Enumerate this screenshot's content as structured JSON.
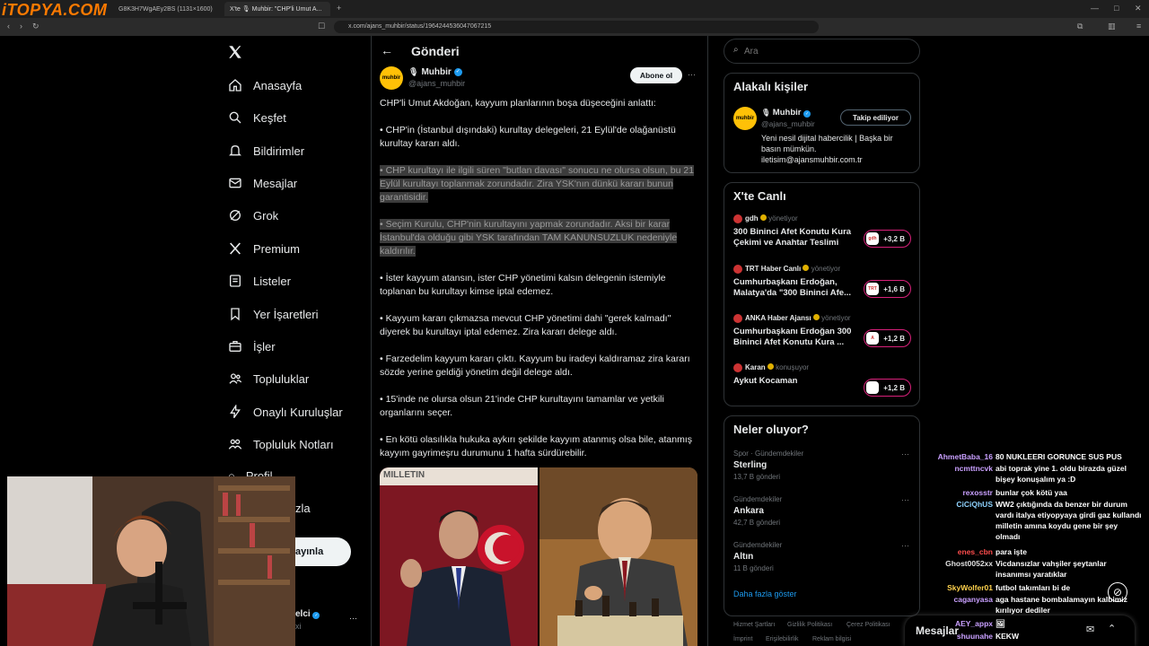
{
  "browser": {
    "logo_text": "iTOPYA.COM",
    "tabs": [
      {
        "label": "G8K3H7WgAEy2BS (1131×1600)"
      },
      {
        "label": "X'te 🎙 Muhbir: \"CHP'li Umut A..."
      }
    ],
    "url": "x.com/ajans_muhbir/status/1964244536047067215",
    "new_tab_symbol": "+"
  },
  "nav": {
    "items": [
      {
        "label": "Anasayfa",
        "icon": "home-icon"
      },
      {
        "label": "Keşfet",
        "icon": "search-icon"
      },
      {
        "label": "Bildirimler",
        "icon": "bell-icon"
      },
      {
        "label": "Mesajlar",
        "icon": "mail-icon"
      },
      {
        "label": "Grok",
        "icon": "grok-icon"
      },
      {
        "label": "Premium",
        "icon": "x-icon"
      },
      {
        "label": "Listeler",
        "icon": "list-icon"
      },
      {
        "label": "Yer İşaretleri",
        "icon": "bookmark-icon"
      },
      {
        "label": "İşler",
        "icon": "briefcase-icon"
      },
      {
        "label": "Topluluklar",
        "icon": "people-icon"
      },
      {
        "label": "Onaylı Kuruluşlar",
        "icon": "bolt-icon"
      },
      {
        "label": "Topluluk Notları",
        "icon": "notes-icon"
      }
    ],
    "partial_labels": {
      "profil": "Profil",
      "more": "zla",
      "post_button": "ayınla",
      "account_name": "elci",
      "account_handle": "xi",
      "more_dots": "···"
    }
  },
  "post": {
    "header_title": "Gönderi",
    "author_name": "Muhbir",
    "author_handle": "@ajans_muhbir",
    "avatar_text": "muhbir",
    "subscribe_label": "Abone ol",
    "more_dots": "···",
    "paragraphs": [
      "CHP'li Umut Akdoğan, kayyum planlarının boşa düşeceğini anlattı:",
      "• CHP'in (İstanbul dışındaki) kurultay delegeleri, 21 Eylül'de olağanüstü kurultay kararı aldı.",
      "• CHP kurultayı ile ilgili süren \"butlan davası\" sonucu ne olursa olsun, bu 21 Eylül kurultayı toplanmak zorundadır. Zira YSK'nın dünkü kararı bunun garantisidir.",
      "• Seçim Kurulu, CHP'nin kurultayını yapmak zorundadır. Aksi bir karar İstanbul'da olduğu gibi YSK tarafından TAM KANUNSUZLUK nedeniyle kaldırılır.",
      "• İster kayyum atansın, ister CHP yönetimi kalsın delegenin istemiyle toplanan bu kurultayı kimse iptal edemez.",
      "• Kayyum kararı çıkmazsa mevcut CHP yönetimi dahi \"gerek kalmadı\" diyerek bu kurultayı iptal edemez. Zira kararı delege aldı.",
      "• Farzedelim kayyum kararı çıktı. Kayyum bu iradeyi kaldıramaz zira kararı sözde yerine geldiği yönetim değil delege aldı.",
      "• 15'inde ne olursa olsun 21'inde CHP kurultayını tamamlar ve yetkili organlarını seçer.",
      "• En kötü olasılıkla hukuka aykırı şekilde kayyım atanmış olsa bile, atanmış kayyım gayrimeşru durumunu 1 hafta sürdürebilir."
    ],
    "image_caption_text": "MILLETIN"
  },
  "search": {
    "placeholder": "Ara"
  },
  "related": {
    "title": "Alakalı kişiler",
    "name": "Muhbir",
    "handle": "@ajans_muhbir",
    "follow_label": "Takip ediliyor",
    "bio": "Yeni nesil dijital habercilik | Başka bir basın mümkün. iletisim@ajansmuhbir.com.tr",
    "avatar_text": "muhbir"
  },
  "live": {
    "title": "X'te Canlı",
    "items": [
      {
        "host": "gdh",
        "role": "yönetiyor",
        "title": "300 Bininci Afet Konutu Kura Çekimi ve Anahtar Teslimi",
        "count": "+3,2 B",
        "badge": "gdh"
      },
      {
        "host": "TRT Haber Canlı",
        "role": "yönetiyor",
        "title": "Cumhurbaşkanı Erdoğan, Malatya'da \"300 Bininci Afe...",
        "count": "+1,6 B",
        "badge": "TRT"
      },
      {
        "host": "ANKA Haber Ajansı",
        "role": "yönetiyor",
        "title": "Cumhurbaşkanı Erdoğan 300 Bininci Afet Konutu Kura ...",
        "count": "+1,2 B",
        "badge": "A"
      },
      {
        "host": "Karan",
        "role": "konuşuyor",
        "title": "Aykut Kocaman",
        "count": "+1,2 B",
        "badge": ""
      }
    ]
  },
  "trends": {
    "title": "Neler oluyor?",
    "items": [
      {
        "context": "Spor · Gündemdekiler",
        "name": "Sterling",
        "count": "13,7 B gönderi"
      },
      {
        "context": "Gündemdekiler",
        "name": "Ankara",
        "count": "42,7 B gönderi"
      },
      {
        "context": "Gündemdekiler",
        "name": "Altın",
        "count": "11 B gönderi"
      }
    ],
    "more_label": "Daha fazla göster"
  },
  "footer": {
    "links": [
      "Hizmet Şartları",
      "Gizlilik Politikası",
      "Çerez Politikası",
      "İmprint",
      "Erişilebilirlik",
      "Reklam bilgisi"
    ],
    "separator": "|"
  },
  "messages_bar": {
    "label": "Mesajlar"
  },
  "chat": [
    {
      "user": "AhmetBaba_16",
      "color": "#c9a0ff",
      "msg": "80 NUKLEERI GORUNCE SUS PUS"
    },
    {
      "user": "ncmttncvk",
      "color": "#c9a0ff",
      "msg": "abi toprak yine 1. oldu birazda güzel bişey konuşalım ya :D"
    },
    {
      "user": "rexosstr",
      "color": "#c9a0ff",
      "msg": "bunlar çok kötü yaa"
    },
    {
      "user": "CiCiQhUS",
      "color": "#8fd3ff",
      "msg": "WW2 çıktığında da benzer bir durum vardı italya etiyopyaya girdi gaz kullandı milletin amına koydu gene bir şey olmadı"
    },
    {
      "user": "enes_cbn",
      "color": "#ff4d4d",
      "msg": "para işte"
    },
    {
      "user": "Ghost0052xx",
      "color": "#e0e0e0",
      "msg": "Vicdansızlar vahşiler şeytanlar insanımsı yaratıklar"
    },
    {
      "user": "SkyWolfer01",
      "color": "#ffd24d",
      "msg": "futbol takımları bi de"
    },
    {
      "user": "caganyasa",
      "color": "#c9a0ff",
      "msg": "aga hastane bombalamayın kalbimiz kırılıyor dediler"
    },
    {
      "user": "AEY_appx",
      "color": "#c9a0ff",
      "msg": "🖼"
    },
    {
      "user": "shuunahe",
      "color": "#c9a0ff",
      "msg": "KEKW"
    }
  ]
}
